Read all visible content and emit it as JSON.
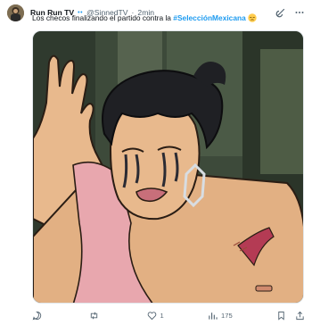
{
  "tweet": {
    "author": {
      "name": "Run Run TV",
      "badges": "••",
      "handle": "@SinnedTV",
      "separator": "·",
      "time": "2min"
    },
    "text_prefix": "Los checos finalizando el partido contra la ",
    "hashtag": "#SelecciónMexicana",
    "emoji": "pensive-face-emoji",
    "media": {
      "kind": "cartoon-image",
      "description_icon": "crying-cartoon-character-image"
    },
    "actions": {
      "reply": {
        "icon": "reply-icon",
        "count": ""
      },
      "retweet": {
        "icon": "retweet-icon",
        "count": ""
      },
      "like": {
        "icon": "heart-icon",
        "count": "1"
      },
      "views": {
        "icon": "views-icon",
        "count": "175"
      },
      "bookmark": {
        "icon": "bookmark-icon"
      },
      "share": {
        "icon": "share-icon"
      }
    }
  },
  "header_icons": [
    "grok-icon",
    "more-icon"
  ],
  "colors": {
    "accent": "#1d9bf0",
    "muted": "#536471",
    "text": "#0f1419"
  }
}
